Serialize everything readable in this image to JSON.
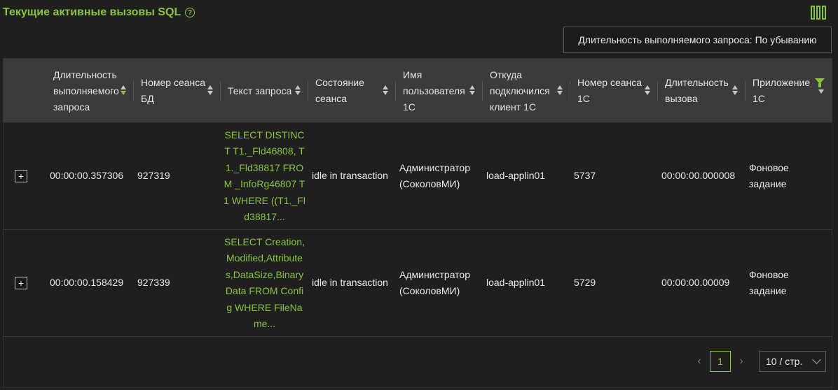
{
  "header": {
    "title": "Текущие активные вызовы SQL",
    "help_icon": "?"
  },
  "sort_select": {
    "value": "Длительность выполняемого запроса: По убыванию"
  },
  "table": {
    "columns": [
      {
        "label": "Длительность выполняемого запроса",
        "sort": "desc"
      },
      {
        "label": "Номер сеанса БД",
        "sort": "none"
      },
      {
        "label": "Текст запроса",
        "sort": "none"
      },
      {
        "label": "Состояние сеанса",
        "sort": "none"
      },
      {
        "label": "Имя пользователя 1С",
        "sort": "none"
      },
      {
        "label": "Откуда подключился клиент 1С",
        "sort": "none"
      },
      {
        "label": "Номер сеанса 1С",
        "sort": "none"
      },
      {
        "label": "Длительность вызова",
        "sort": "none"
      },
      {
        "label": "Приложение 1С",
        "sort": "none",
        "filter": true
      }
    ],
    "rows": [
      {
        "expand": "+",
        "duration": "00:00:00.357306",
        "db_session": "927319",
        "query_text": "SELECT DISTINCT T1._Fld46808, T1._Fld38817 FROM _InfoRg46807 T1 WHERE ((T1._Fld38817...",
        "state": "idle in transaction",
        "user": "Администратор (СоколовМИ)",
        "client_host": "load-applin01",
        "session_1c": "5737",
        "call_duration": "00:00:00.000008",
        "app": "Фоновое задание"
      },
      {
        "expand": "+",
        "duration": "00:00:00.158429",
        "db_session": "927339",
        "query_text": "SELECT Creation,Modified,Attributes,DataSize,BinaryData FROM Config WHERE FileName...",
        "state": "idle in transaction",
        "user": "Администратор (СоколовМИ)",
        "client_host": "load-applin01",
        "session_1c": "5729",
        "call_duration": "00:00:00.00009",
        "app": "Фоновое задание"
      }
    ]
  },
  "pagination": {
    "prev": "‹",
    "current_page": "1",
    "next": "›",
    "page_size": "10 / стр."
  },
  "colors": {
    "accent": "#8ac43f",
    "background": "#1f1f1f",
    "header_bg": "#3b3b3b"
  }
}
